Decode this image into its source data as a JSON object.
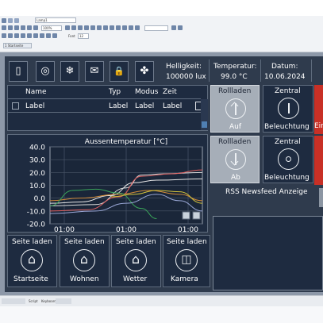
{
  "editor": {
    "tab_label": "Lamp1",
    "screen_tab": "1 Startseite",
    "zoom_value": "100%",
    "font_label": "Font",
    "font_size_value": "12"
  },
  "header": {
    "helligkeit_label": "Helligkeit:",
    "helligkeit_value": "100000 lux",
    "temperatur_label": "Temperatur:",
    "temperatur_value": "99.0 °C",
    "datum_label": "Datum:",
    "datum_value": "10.06.2024"
  },
  "icon_buttons": [
    {
      "name": "building-icon",
      "glyph": "▯"
    },
    {
      "name": "washer-icon",
      "glyph": "◎"
    },
    {
      "name": "snowflake-icon",
      "glyph": "❄"
    },
    {
      "name": "mail-icon",
      "glyph": "✉"
    },
    {
      "name": "lock-icon",
      "glyph": "🔒"
    },
    {
      "name": "fan-icon",
      "glyph": "✤"
    }
  ],
  "table": {
    "columns": [
      "Name",
      "Typ",
      "Modus",
      "Zeit"
    ],
    "row": [
      "Label",
      "Label",
      "Label",
      "Label"
    ]
  },
  "controls": {
    "rollladen_label": "Rollladen",
    "auf_label": "Auf",
    "ab_label": "Ab",
    "zentral_label": "Zentral",
    "beleuchtung_label": "Beleuchtung",
    "ein_label": "Ein"
  },
  "rss": {
    "title": "RSS Newsfeed Anzeige"
  },
  "chart_data": {
    "type": "line",
    "title": "Aussentemperatur [°C]",
    "ylim": [
      -20,
      40
    ],
    "yticks": [
      "40.0",
      "30.0",
      "20.0",
      "10.0",
      "0.0",
      "-10.0",
      "-20.0"
    ],
    "xticks": [
      "01:00",
      "01:00",
      "01:00"
    ],
    "grid": true,
    "series": [
      {
        "color": "#e8e8e8",
        "points": [
          [
            0,
            -4
          ],
          [
            0.2,
            -3
          ],
          [
            0.4,
            2
          ],
          [
            0.55,
            12
          ],
          [
            0.7,
            14
          ],
          [
            1,
            15
          ]
        ]
      },
      {
        "color": "#d9d9d9",
        "points": [
          [
            0,
            -6
          ],
          [
            0.3,
            -5
          ],
          [
            0.5,
            8
          ],
          [
            0.6,
            18
          ],
          [
            0.75,
            19
          ],
          [
            1,
            20
          ]
        ]
      },
      {
        "color": "#e06060",
        "points": [
          [
            0,
            -10
          ],
          [
            0.25,
            -9
          ],
          [
            0.45,
            1
          ],
          [
            0.6,
            17
          ],
          [
            0.8,
            19
          ],
          [
            1,
            22
          ]
        ]
      },
      {
        "color": "#d08a3a",
        "points": [
          [
            0,
            -2
          ],
          [
            0.2,
            0
          ],
          [
            0.45,
            3
          ],
          [
            0.65,
            6
          ],
          [
            0.85,
            3
          ],
          [
            1,
            -2
          ]
        ]
      },
      {
        "color": "#3aa55a",
        "points": [
          [
            0,
            -6
          ],
          [
            0.15,
            6
          ],
          [
            0.3,
            7
          ],
          [
            0.45,
            4
          ],
          [
            0.6,
            -8
          ],
          [
            0.7,
            -16
          ]
        ]
      },
      {
        "color": "#9aa7d6",
        "points": [
          [
            0,
            -12
          ],
          [
            0.3,
            -10
          ],
          [
            0.5,
            -4
          ],
          [
            0.7,
            3
          ],
          [
            0.85,
            -2
          ],
          [
            1,
            -10
          ]
        ]
      },
      {
        "color": "#d3c23a",
        "points": [
          [
            0.4,
            1
          ],
          [
            0.55,
            3
          ],
          [
            0.7,
            6
          ],
          [
            0.85,
            5
          ],
          [
            1,
            -4
          ]
        ]
      }
    ]
  },
  "nav_buttons": [
    {
      "top": "Seite laden",
      "bottom": "Startseite",
      "icon": "house-icon",
      "glyph": "⌂"
    },
    {
      "top": "Seite laden",
      "bottom": "Wohnen",
      "icon": "house-icon",
      "glyph": "⌂"
    },
    {
      "top": "Seite laden",
      "bottom": "Wetter",
      "icon": "house-icon",
      "glyph": "⌂"
    },
    {
      "top": "Seite laden",
      "bottom": "Kamera",
      "icon": "camera-icon",
      "glyph": "◫"
    }
  ],
  "statusbar": {
    "left_label": "Script",
    "right_label": "Keyboard"
  }
}
